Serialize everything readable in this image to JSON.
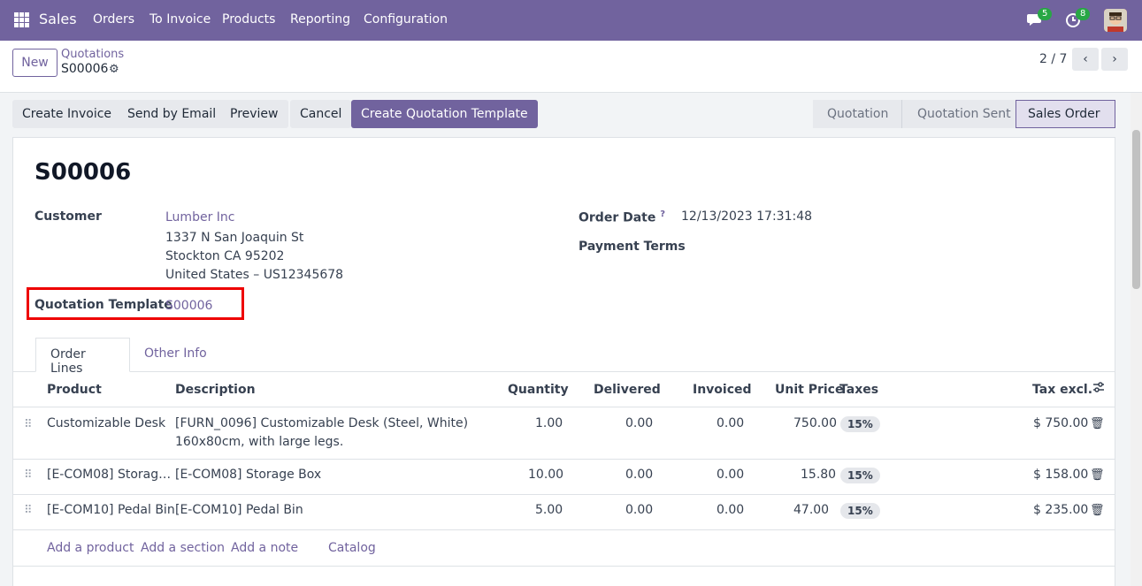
{
  "navbar": {
    "app_name": "Sales",
    "menu": [
      "Orders",
      "To Invoice",
      "Products",
      "Reporting",
      "Configuration"
    ],
    "messages_count": "5",
    "activities_count": "8"
  },
  "control_panel": {
    "new_label": "New",
    "breadcrumb_parent": "Quotations",
    "breadcrumb_current": "S00006",
    "pager": "2 / 7"
  },
  "actions": {
    "create_invoice": "Create Invoice",
    "send_email": "Send by Email",
    "preview": "Preview",
    "cancel": "Cancel",
    "create_template": "Create Quotation Template"
  },
  "stages": [
    "Quotation",
    "Quotation Sent",
    "Sales Order"
  ],
  "form": {
    "title": "S00006",
    "customer_label": "Customer",
    "customer_name": "Lumber Inc",
    "address_line1": "1337 N San Joaquin St",
    "address_line2": "Stockton CA 95202",
    "address_line3": "United States – US12345678",
    "template_label": "Quotation Template",
    "template_value": "S00006",
    "order_date_label": "Order Date",
    "order_date_help": "?",
    "order_date_value": "12/13/2023 17:31:48",
    "payment_terms_label": "Payment Terms"
  },
  "tabs": [
    "Order Lines",
    "Other Info"
  ],
  "table": {
    "headers": {
      "product": "Product",
      "description": "Description",
      "quantity": "Quantity",
      "delivered": "Delivered",
      "invoiced": "Invoiced",
      "unit_price": "Unit Price",
      "taxes": "Taxes",
      "tax_excl": "Tax excl."
    },
    "rows": [
      {
        "product": "Customizable Desk",
        "description1": "[FURN_0096] Customizable Desk (Steel, White)",
        "description2": "160x80cm, with large legs.",
        "quantity": "1.00",
        "delivered": "0.00",
        "invoiced": "0.00",
        "unit_price": "750.00",
        "tax": "15%",
        "subtotal": "$ 750.00"
      },
      {
        "product": "[E-COM08] Storag…",
        "description1": "[E-COM08] Storage Box",
        "description2": "",
        "quantity": "10.00",
        "delivered": "0.00",
        "invoiced": "0.00",
        "unit_price": "15.80",
        "tax": "15%",
        "subtotal": "$ 158.00"
      },
      {
        "product": "[E-COM10] Pedal Bin",
        "description1": "[E-COM10] Pedal Bin",
        "description2": "",
        "quantity": "5.00",
        "delivered": "0.00",
        "invoiced": "0.00",
        "unit_price": "47.00",
        "tax": "15%",
        "subtotal": "$ 235.00"
      }
    ],
    "add_product": "Add a product",
    "add_section": "Add a section",
    "add_note": "Add a note",
    "catalog": "Catalog"
  }
}
